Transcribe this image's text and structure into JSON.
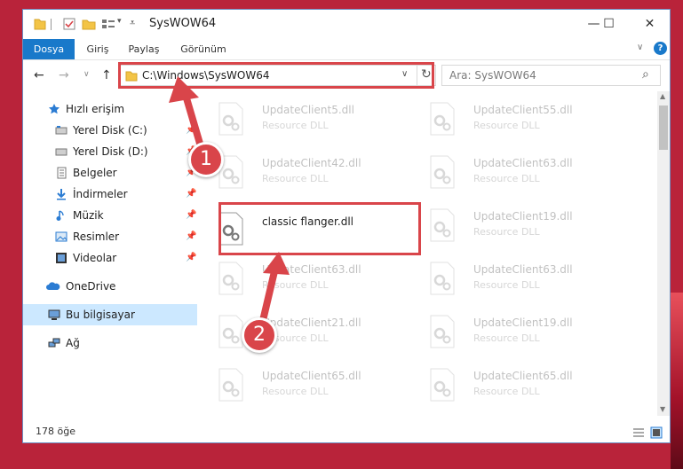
{
  "window": {
    "title": "SysWOW64",
    "accent": "#1979ca",
    "controls": {
      "minimize": "—",
      "maximize": "☐",
      "close": "✕"
    }
  },
  "ribbon": {
    "tabs": [
      {
        "label": "Dosya",
        "active": true
      },
      {
        "label": "Giriş"
      },
      {
        "label": "Paylaş"
      },
      {
        "label": "Görünüm"
      }
    ],
    "expand_glyph": "∨",
    "help_glyph": "?"
  },
  "nav": {
    "back_glyph": "←",
    "forward_glyph": "→",
    "dropdown_glyph": "∨",
    "up_glyph": "↑",
    "address": "C:\\Windows\\SysWOW64",
    "address_dropdown_glyph": "∨",
    "refresh_glyph": "↻",
    "search_placeholder": "Ara: SysWOW64",
    "search_glyph": "⌕"
  },
  "sidebar": {
    "items": [
      {
        "label": "Hızlı erişim",
        "icon": "star-icon"
      },
      {
        "label": "Yerel Disk (C:)",
        "icon": "drive-icon",
        "pinned": true
      },
      {
        "label": "Yerel Disk (D:)",
        "icon": "drive-icon",
        "pinned": true
      },
      {
        "label": "Belgeler",
        "icon": "documents-icon",
        "pinned": true
      },
      {
        "label": "İndirmeler",
        "icon": "download-icon",
        "pinned": true
      },
      {
        "label": "Müzik",
        "icon": "music-icon",
        "pinned": true
      },
      {
        "label": "Resimler",
        "icon": "pictures-icon",
        "pinned": true
      },
      {
        "label": "Videolar",
        "icon": "videos-icon",
        "pinned": true
      },
      {
        "label": "OneDrive",
        "icon": "cloud-icon"
      },
      {
        "label": "Bu bilgisayar",
        "icon": "computer-icon",
        "selected": true
      },
      {
        "label": "Ağ",
        "icon": "network-icon"
      }
    ]
  },
  "files": {
    "column1": [
      {
        "name": "UpdateClient5.dll",
        "type": "Resource DLL"
      },
      {
        "name": "UpdateClient42.dll",
        "type": "Resource DLL"
      },
      {
        "name": "classic flanger.dll",
        "type": "",
        "highlighted": true
      },
      {
        "name": "UpdateClient63.dll",
        "type": "Resource DLL"
      },
      {
        "name": "UpdateClient21.dll",
        "type": "Resource DLL"
      },
      {
        "name": "UpdateClient65.dll",
        "type": "Resource DLL"
      }
    ],
    "column2": [
      {
        "name": "UpdateClient55.dll",
        "type": "Resource DLL"
      },
      {
        "name": "UpdateClient63.dll",
        "type": "Resource DLL"
      },
      {
        "name": "UpdateClient19.dll",
        "type": "Resource DLL"
      },
      {
        "name": "UpdateClient63.dll",
        "type": "Resource DLL"
      },
      {
        "name": "UpdateClient19.dll",
        "type": "Resource DLL"
      },
      {
        "name": "UpdateClient65.dll",
        "type": "Resource DLL"
      }
    ]
  },
  "status": {
    "count": "178 öğe"
  },
  "annotations": {
    "badge1": "1",
    "badge2": "2",
    "color": "#d9454a"
  }
}
